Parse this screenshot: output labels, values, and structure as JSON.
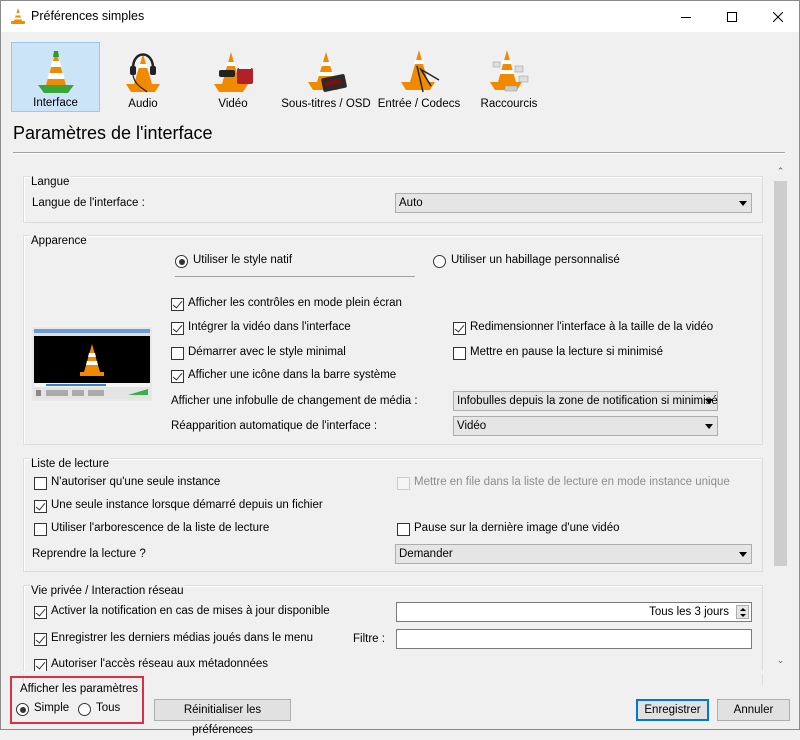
{
  "window": {
    "title": "Préférences simples",
    "controls": {
      "minimize": "—",
      "maximize": "☐",
      "close": "✕"
    }
  },
  "categories": [
    {
      "label": "Interface",
      "icon": "interface-cone-icon",
      "selected": true
    },
    {
      "label": "Audio",
      "icon": "audio-cone-icon",
      "selected": false
    },
    {
      "label": "Vidéo",
      "icon": "video-cone-icon",
      "selected": false
    },
    {
      "label": "Sous-titres / OSD",
      "icon": "subtitles-cone-icon",
      "selected": false
    },
    {
      "label": "Entrée / Codecs",
      "icon": "input-codecs-cone-icon",
      "selected": false
    },
    {
      "label": "Raccourcis",
      "icon": "hotkeys-cone-icon",
      "selected": false
    }
  ],
  "panel": {
    "title": "Paramètres de l'interface",
    "langue": {
      "group_label": "Langue",
      "interface_language_label": "Langue de l'interface :",
      "interface_language_value": "Auto"
    },
    "apparence": {
      "group_label": "Apparence",
      "native_style_label": "Utiliser le style natif",
      "native_style_selected": true,
      "custom_skin_label": "Utiliser un habillage personnalisé",
      "custom_skin_selected": false,
      "checks": [
        {
          "label": "Afficher les contrôles en mode plein écran",
          "checked": true
        },
        {
          "label": "Intégrer la vidéo dans l'interface",
          "checked": true
        },
        {
          "label": "Démarrer avec le style minimal",
          "checked": false
        },
        {
          "label": "Afficher une icône dans la barre système",
          "checked": true
        },
        {
          "label": "Redimensionner l'interface à la taille de la vidéo",
          "checked": true
        },
        {
          "label": "Mettre en pause la lecture si minimisé",
          "checked": false
        }
      ],
      "media_popup_label": "Afficher une infobulle de changement de média :",
      "media_popup_value": "Infobulles depuis la zone de notification si minimisé",
      "auto_raise_label": "Réapparition automatique de l'interface :",
      "auto_raise_value": "Vidéo"
    },
    "playlist": {
      "group_label": "Liste de lecture",
      "checks": [
        {
          "label": "N'autoriser qu'une seule instance",
          "checked": false,
          "disabled": false
        },
        {
          "label": "Une seule instance lorsque démarré depuis un fichier",
          "checked": true,
          "disabled": false
        },
        {
          "label": "Utiliser l'arborescence de la liste de lecture",
          "checked": false,
          "disabled": false
        },
        {
          "label": "Mettre en file dans la liste de lecture en mode instance unique",
          "checked": false,
          "disabled": true
        },
        {
          "label": "Pause sur la dernière image d'une vidéo",
          "checked": false,
          "disabled": false
        }
      ],
      "resume_label": "Reprendre la lecture ?",
      "resume_value": "Demander"
    },
    "privacy": {
      "group_label": "Vie privée / Interaction réseau",
      "checks": [
        {
          "label": "Activer la notification en cas de mises à jour disponible",
          "checked": true
        },
        {
          "label": "Enregistrer les derniers médias joués dans le menu",
          "checked": true
        },
        {
          "label": "Autoriser l'accès réseau aux métadonnées",
          "checked": true
        }
      ],
      "update_interval_value": "Tous les 3 jours",
      "filter_label": "Filtre :",
      "filter_value": ""
    }
  },
  "footer": {
    "show_settings_label": "Afficher les paramètres",
    "simple_label": "Simple",
    "simple_selected": true,
    "all_label": "Tous",
    "all_selected": false,
    "reset_label": "Réinitialiser les préférences",
    "save_label": "Enregistrer",
    "cancel_label": "Annuler"
  }
}
